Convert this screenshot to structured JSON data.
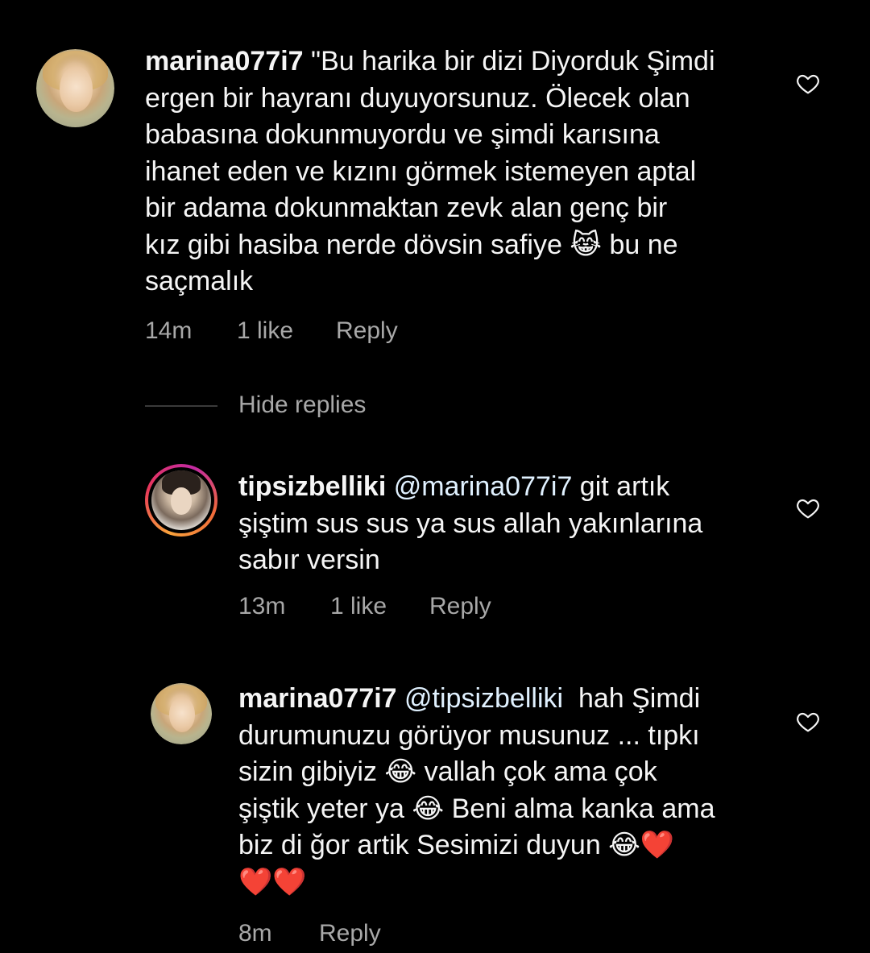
{
  "comments": [
    {
      "username": "marina077i7",
      "mention": "",
      "body": " \"Bu harika bir dizi Diyorduk Şimdi\nergen bir hayranı duyuyorsunuz. Ölecek olan\nbabasına dokunmuyordu ve şimdi karısına\nihanet eden ve kızını görmek istemeyen aptal\nbir adama dokunmaktan zevk alan genç bir\nkız gibi hasiba nerde dövsin safiye 😹 bu ne\nsaçmalık",
      "time": "14m",
      "likes": "1 like",
      "reply": "Reply"
    },
    {
      "username": "tipsizbelliki",
      "mention": "@marina077i7",
      "body": " git artık\nşiştim sus sus ya sus allah yakınlarına\nsabır versin",
      "time": "13m",
      "likes": "1 like",
      "reply": "Reply"
    },
    {
      "username": "marina077i7",
      "mention": "@tipsizbelliki",
      "body": "  hah Şimdi\ndurumunuzu görüyor musunuz ... tıpkı\nsizin gibiyiz 😂 vallah çok ama çok\nşiştik yeter ya 😂 Beni alma kanka ama\nbiz di ğor artik Sesimizi duyun 😂❤️\n❤️❤️",
      "time": "8m",
      "likes": "",
      "reply": "Reply"
    }
  ],
  "hide_replies": "Hide replies",
  "colors": {
    "background": "#000000",
    "text": "#f5f5f5",
    "meta": "#a8a8a8",
    "mention": "#e0f1ff"
  },
  "icons": {
    "like": "heart-outline-icon"
  }
}
